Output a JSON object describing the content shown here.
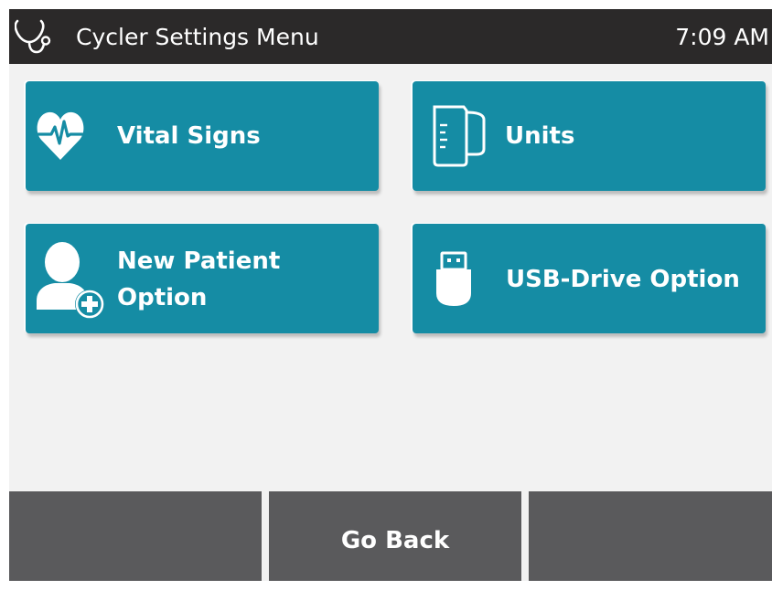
{
  "header": {
    "title": "Cycler Settings Menu",
    "time": "7:09 AM",
    "icon": "stethoscope-icon"
  },
  "tiles": [
    {
      "label": "Vital Signs",
      "icon": "heart-pulse-icon"
    },
    {
      "label": "Units",
      "icon": "measuring-cup-icon"
    },
    {
      "label_line1": "New Patient",
      "label_line2": "Option",
      "icon": "add-patient-icon"
    },
    {
      "label": "USB-Drive Option",
      "icon": "usb-drive-icon"
    }
  ],
  "footer": {
    "left_label": "",
    "center_label": "Go Back",
    "right_label": ""
  },
  "colors": {
    "header_bg": "#2b2929",
    "tile_bg": "#158ca4",
    "footer_bg": "#5a5a5c",
    "screen_bg": "#f2f2f2"
  }
}
